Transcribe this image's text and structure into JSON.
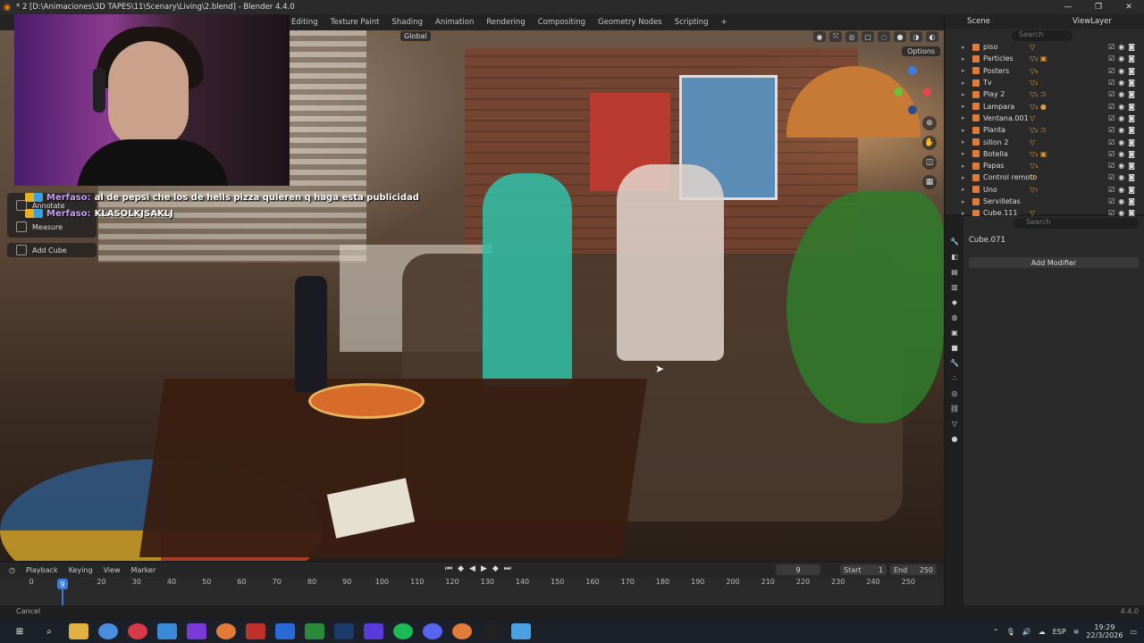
{
  "window": {
    "title": "* 2 [D:\\Animaciones\\3D TAPES\\11\\Scenary\\Living\\2.blend] - Blender 4.4.0",
    "controls": [
      "—",
      "❐",
      "✕"
    ]
  },
  "workspaces": [
    "Editing",
    "Texture Paint",
    "Shading",
    "Animation",
    "Rendering",
    "Compositing",
    "Geometry Nodes",
    "Scripting",
    "+"
  ],
  "viewport": {
    "orientation": "Global",
    "options_label": "Options",
    "tools": [
      {
        "label": "Annotate"
      },
      {
        "label": "Measure"
      },
      {
        "label": "Add Cube"
      }
    ]
  },
  "chat": [
    {
      "user": "Merfaso:",
      "message": "al de pepsi che los de hells pizza quieren q haga esta publicidad"
    },
    {
      "user": "Merfaso:",
      "message": "KLASOLKJSAKLJ"
    }
  ],
  "timeline": {
    "menus": [
      "Playback",
      "Keying",
      "View",
      "Marker"
    ],
    "current_frame": "9",
    "start_label": "Start",
    "start": "1",
    "end_label": "End",
    "end": "250",
    "ticks": [
      "0",
      "20",
      "30",
      "40",
      "50",
      "60",
      "70",
      "80",
      "90",
      "100",
      "110",
      "120",
      "130",
      "140",
      "150",
      "160",
      "170",
      "180",
      "190",
      "200",
      "210",
      "220",
      "230",
      "240",
      "250"
    ],
    "playhead_label": "9"
  },
  "statusbar": {
    "left": "Cancel",
    "version": "4.4.0"
  },
  "outliner": {
    "scene_label": "Scene",
    "viewlayer_label": "ViewLayer",
    "search_placeholder": "Search",
    "items": [
      {
        "name": "piso",
        "mods": "▽"
      },
      {
        "name": "Particles",
        "mods": "▽₂ ▣"
      },
      {
        "name": "Posters",
        "mods": "▽₉"
      },
      {
        "name": "Tv",
        "mods": "▽₂"
      },
      {
        "name": "Play 2",
        "mods": "▽₂ ⊃"
      },
      {
        "name": "Lampara",
        "mods": "▽₃ ●"
      },
      {
        "name": "Ventana.001",
        "mods": "▽"
      },
      {
        "name": "Planta",
        "mods": "▽₂ ⊃"
      },
      {
        "name": "sillon 2",
        "mods": "▽"
      },
      {
        "name": "Botella",
        "mods": "▽₂ ▣"
      },
      {
        "name": "Papas",
        "mods": "▽₃"
      },
      {
        "name": "Control remoto",
        "mods": "▽"
      },
      {
        "name": "Uno",
        "mods": "▽₇"
      },
      {
        "name": "Servilletas",
        "mods": ""
      },
      {
        "name": "Cube.111",
        "mods": "▽"
      }
    ]
  },
  "properties": {
    "search_placeholder": "Search",
    "object_name": "Cube.071",
    "add_modifier": "Add Modifier"
  },
  "taskbar": {
    "tray_lang": "ESP",
    "time": "19:29",
    "date": "22/3/2026"
  }
}
